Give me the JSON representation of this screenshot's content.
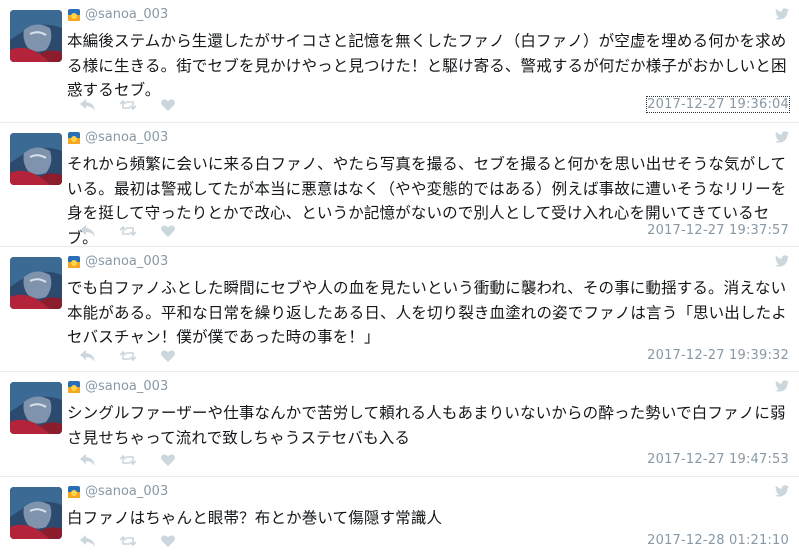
{
  "tweets": [
    {
      "handle": "@sanoa_003",
      "text": "本編後ステムから生還したがサイコさと記憶を無くしたファノ（白ファノ）が空虚を埋める何かを求める様に生きる。街でセブを見かけやっと見つけた！と駆け寄る、警戒するが何だか様子がおかしいと困惑するセブ。",
      "timestamp": "2017-12-27 19:36:04"
    },
    {
      "handle": "@sanoa_003",
      "text": "それから頻繁に会いに来る白ファノ、やたら写真を撮る、セブを撮ると何かを思い出せそうな気がしている。最初は警戒してたが本当に悪意はなく（やや変態的ではある）例えば事故に遭いそうなリリーを身を挺して守ったりとかで改心、というか記憶がないので別人として受け入れ心を開いてきているセブ。",
      "timestamp": "2017-12-27 19:37:57"
    },
    {
      "handle": "@sanoa_003",
      "text": "でも白ファノふとした瞬間にセブや人の血を見たいという衝動に襲われ、その事に動揺する。消えない本能がある。平和な日常を繰り返したある日、人を切り裂き血塗れの姿でファノは言う「思い出したよセバスチャン！僕が僕であった時の事を！」",
      "timestamp": "2017-12-27 19:39:32"
    },
    {
      "handle": "@sanoa_003",
      "text": "シングルファーザーや仕事なんかで苦労して頼れる人もあまりいないからの酔った勢いで白ファノに弱さ見せちゃって流れで致しちゃうステセバも入る",
      "timestamp": "2017-12-27 19:47:53"
    },
    {
      "handle": "@sanoa_003",
      "text": "白ファノはちゃんと眼帯？布とか巻いて傷隠す常識人",
      "timestamp": "2017-12-28 01:21:10"
    }
  ],
  "icons": {
    "reply": "reply-icon",
    "retweet": "retweet-icon",
    "like": "heart-icon",
    "bird": "twitter-bird-icon",
    "badge": "sunset-badge-icon"
  },
  "colors": {
    "text": "#14171a",
    "meta": "#8899a6",
    "action": "#ccd6dd",
    "divider": "#e6ecf0"
  }
}
